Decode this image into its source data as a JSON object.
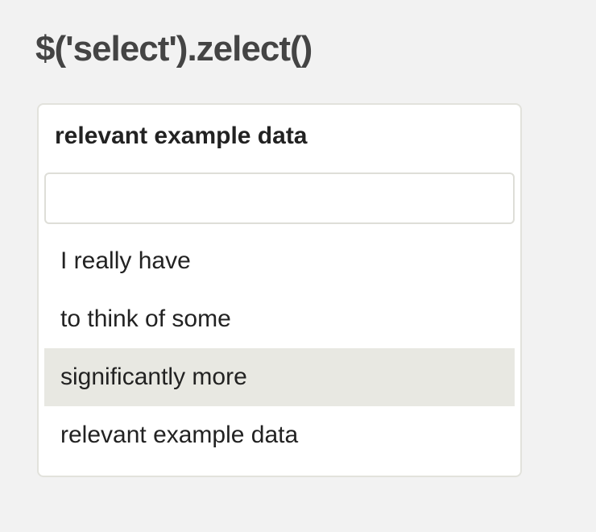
{
  "page": {
    "title": "$('select').zelect()"
  },
  "zelect": {
    "selected": "relevant example data",
    "search": {
      "value": "",
      "placeholder": ""
    },
    "options": [
      {
        "label": "I really have",
        "highlighted": false
      },
      {
        "label": "to think of some",
        "highlighted": false
      },
      {
        "label": "significantly more",
        "highlighted": true
      },
      {
        "label": "relevant example data",
        "highlighted": false
      }
    ]
  },
  "colors": {
    "background": "#f2f2f2",
    "title": "#444444",
    "panel": "#ffffff",
    "border": "#e2e2dc",
    "highlight": "#e8e8e2",
    "text": "#222222"
  }
}
